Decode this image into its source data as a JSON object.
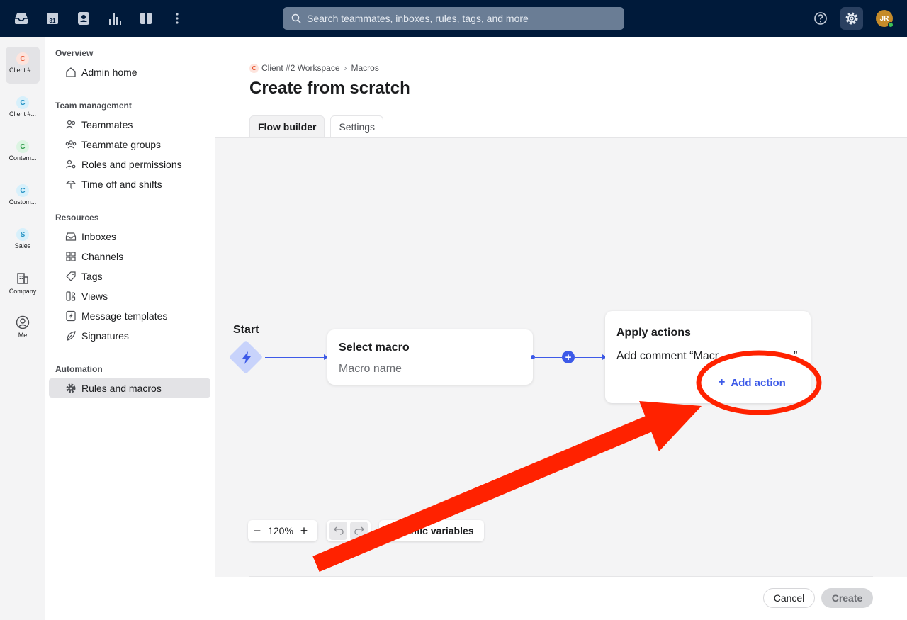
{
  "topbar": {
    "search_placeholder": "Search teammates, inboxes, rules, tags, and more",
    "calendar_day": "31",
    "avatar_initials": "JR"
  },
  "rail": {
    "items": [
      {
        "badge": "C",
        "label": "Client #...",
        "badge_bg": "#fde4dd",
        "badge_fg": "#e8532e"
      },
      {
        "badge": "C",
        "label": "Client #...",
        "badge_bg": "#d7f0fb",
        "badge_fg": "#1f8fc2"
      },
      {
        "badge": "C",
        "label": "Contem...",
        "badge_bg": "#dcf4e2",
        "badge_fg": "#2e9a4a"
      },
      {
        "badge": "C",
        "label": "Custom...",
        "badge_bg": "#d7f0fb",
        "badge_fg": "#1f8fc2"
      },
      {
        "badge": "S",
        "label": "Sales",
        "badge_bg": "#d7f0fb",
        "badge_fg": "#1f8fc2"
      }
    ],
    "company_label": "Company",
    "me_label": "Me"
  },
  "nav": {
    "overview_title": "Overview",
    "admin_home": "Admin home",
    "team_title": "Team management",
    "teammates": "Teammates",
    "teammate_groups": "Teammate groups",
    "roles": "Roles and permissions",
    "time_off": "Time off and shifts",
    "resources_title": "Resources",
    "inboxes": "Inboxes",
    "channels": "Channels",
    "tags": "Tags",
    "views": "Views",
    "message_templates": "Message templates",
    "signatures": "Signatures",
    "automation_title": "Automation",
    "rules_macros": "Rules and macros"
  },
  "main": {
    "breadcrumb_badge": "C",
    "breadcrumb_workspace": "Client #2 Workspace",
    "breadcrumb_sep": "›",
    "breadcrumb_page": "Macros",
    "title": "Create from scratch",
    "tabs": [
      "Flow builder",
      "Settings"
    ]
  },
  "flow": {
    "start_label": "Start",
    "select_title": "Select macro",
    "select_placeholder": "Macro name",
    "apply_title": "Apply actions",
    "apply_action_text": "Add comment  “Macr",
    "apply_action_end": "”",
    "plus": "+",
    "add_action_plus": "+",
    "add_action_label": "Add action"
  },
  "controls": {
    "zoom_minus": "−",
    "zoom_value": "120%",
    "zoom_plus": "+",
    "dyn_braces": "{",
    "dyn_label": "ynamic variables"
  },
  "footer": {
    "cancel": "Cancel",
    "create": "Create"
  },
  "colors": {
    "topbar_bg": "#001a3a",
    "accent_blue": "#3d5ae8",
    "annotation_red": "#ff2200"
  }
}
